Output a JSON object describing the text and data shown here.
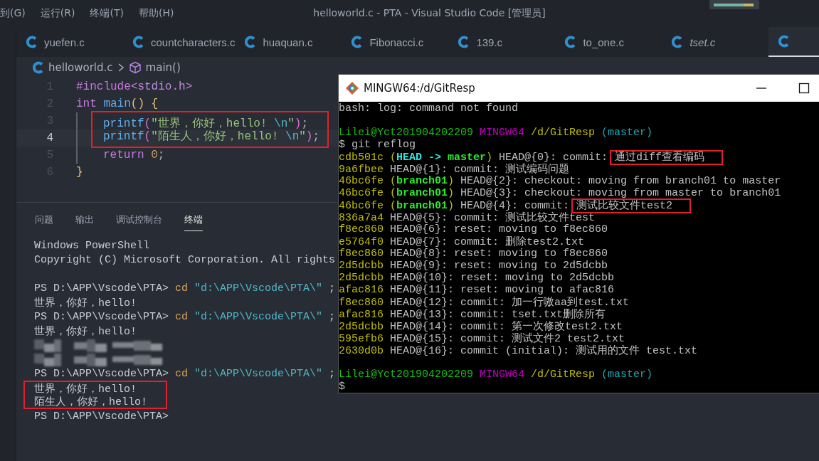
{
  "menu": [
    "到(G)",
    "运行(R)",
    "终端(T)",
    "帮助(H)"
  ],
  "window_title": "helloworld.c - PTA - Visual Studio Code [管理员]",
  "tabs": [
    {
      "label": "yuefen.c",
      "selected": false,
      "preview": false
    },
    {
      "label": "countcharacters.c",
      "selected": false,
      "preview": false
    },
    {
      "label": "huaquan.c",
      "selected": false,
      "preview": false
    },
    {
      "label": "Fibonacci.c",
      "selected": false,
      "preview": false
    },
    {
      "label": "139.c",
      "selected": false,
      "preview": false
    },
    {
      "label": "to_one.c",
      "selected": false,
      "preview": false
    },
    {
      "label": "tset.c",
      "selected": false,
      "preview": true
    },
    {
      "selected": true,
      "preview": false
    }
  ],
  "breadcrumb": {
    "file": "helloworld.c",
    "symbol": "main()"
  },
  "editor_lines": [
    {
      "number": "1",
      "current": false,
      "boxed": false,
      "indented": false,
      "tokens": [
        {
          "kind": "keyword",
          "text": "#include"
        },
        {
          "kind": "header",
          "text": "<stdio.h>"
        }
      ]
    },
    {
      "number": "2",
      "current": false,
      "boxed": false,
      "indented": false,
      "tokens": [
        {
          "kind": "keyword",
          "text": "int "
        },
        {
          "kind": "func",
          "text": "main"
        },
        {
          "kind": "bracket",
          "text": "() {"
        }
      ]
    },
    {
      "number": "3",
      "current": false,
      "boxed": true,
      "indented": true,
      "tokens": [
        {
          "kind": "func",
          "text": "printf"
        },
        {
          "kind": "bracket2",
          "text": "("
        },
        {
          "kind": "string",
          "text": "\"世界，你好，hello! "
        },
        {
          "kind": "escape",
          "text": "\\n"
        },
        {
          "kind": "string",
          "text": "\""
        },
        {
          "kind": "bracket2",
          "text": ")"
        },
        {
          "kind": "punct",
          "text": ";"
        }
      ]
    },
    {
      "number": "4",
      "current": true,
      "boxed": true,
      "indented": true,
      "tokens": [
        {
          "kind": "func",
          "text": "printf"
        },
        {
          "kind": "bracket2",
          "text": "("
        },
        {
          "kind": "string",
          "text": "\"陌生人，你好，hello! "
        },
        {
          "kind": "escape",
          "text": "\\n"
        },
        {
          "kind": "string",
          "text": "\""
        },
        {
          "kind": "bracket2",
          "text": ")"
        },
        {
          "kind": "punct",
          "text": ";"
        }
      ]
    },
    {
      "number": "5",
      "current": false,
      "boxed": false,
      "indented": true,
      "tokens": [
        {
          "kind": "keyword",
          "text": "return "
        },
        {
          "kind": "number",
          "text": "0"
        },
        {
          "kind": "punct",
          "text": ";"
        }
      ]
    },
    {
      "number": "6",
      "current": false,
      "boxed": false,
      "indented": false,
      "tokens": [
        {
          "kind": "bracket",
          "text": "}"
        }
      ]
    }
  ],
  "panel_tabs": [
    {
      "label": "问题",
      "selected": false
    },
    {
      "label": "输出",
      "selected": false
    },
    {
      "label": "调试控制台",
      "selected": false
    },
    {
      "label": "终端",
      "selected": true
    }
  ],
  "terminal_lines": [
    {
      "kind": "text",
      "boxed": false,
      "tokens": [
        {
          "kind": "plain",
          "text": "Windows PowerShell"
        }
      ]
    },
    {
      "kind": "text",
      "boxed": false,
      "tokens": [
        {
          "kind": "plain",
          "text": "Copyright (C) Microsoft Corporation. All rights"
        }
      ]
    },
    {
      "kind": "blank"
    },
    {
      "kind": "text",
      "boxed": false,
      "tokens": [
        {
          "kind": "plain",
          "text": "PS D:\\APP\\Vscode\\PTA> "
        },
        {
          "kind": "cmd",
          "text": "cd "
        },
        {
          "kind": "string",
          "text": "\"d:\\APP\\Vscode\\PTA\\\""
        },
        {
          "kind": "plain",
          "text": " ;"
        }
      ]
    },
    {
      "kind": "text",
      "boxed": false,
      "tokens": [
        {
          "kind": "plain",
          "text": "世界，你好，hello!"
        }
      ]
    },
    {
      "kind": "text",
      "boxed": false,
      "tokens": [
        {
          "kind": "plain",
          "text": "PS D:\\APP\\Vscode\\PTA> "
        },
        {
          "kind": "cmd",
          "text": "cd "
        },
        {
          "kind": "string",
          "text": "\"d:\\APP\\Vscode\\PTA\\\""
        },
        {
          "kind": "plain",
          "text": " ;"
        }
      ]
    },
    {
      "kind": "text",
      "boxed": false,
      "tokens": [
        {
          "kind": "plain",
          "text": "世界，你好，hello!"
        }
      ]
    },
    {
      "kind": "redacted"
    },
    {
      "kind": "redacted"
    },
    {
      "kind": "text",
      "boxed": false,
      "tokens": [
        {
          "kind": "plain",
          "text": "PS D:\\APP\\Vscode\\PTA> "
        },
        {
          "kind": "cmd",
          "text": "cd "
        },
        {
          "kind": "string",
          "text": "\"d:\\APP\\Vscode\\PTA\\\""
        },
        {
          "kind": "plain",
          "text": " ;"
        }
      ]
    },
    {
      "kind": "text",
      "boxed": true,
      "tokens": [
        {
          "kind": "plain",
          "text": "世界，你好，hello!"
        }
      ]
    },
    {
      "kind": "text",
      "boxed": true,
      "tokens": [
        {
          "kind": "plain",
          "text": "陌生人，你好，hello!"
        }
      ]
    },
    {
      "kind": "text",
      "boxed": false,
      "tokens": [
        {
          "kind": "plain",
          "text": "PS D:\\APP\\Vscode\\PTA>"
        }
      ]
    }
  ],
  "git_window": {
    "title": "MINGW64:/d/GitResp",
    "lines": [
      {
        "kind": "text",
        "tokens": [
          {
            "kind": "text",
            "text": "bash: log: command not found"
          }
        ]
      },
      {
        "kind": "blank"
      },
      {
        "kind": "text",
        "tokens": [
          {
            "kind": "user",
            "text": "Lilei@Yct201904202209 "
          },
          {
            "kind": "host",
            "text": "MINGW64 "
          },
          {
            "kind": "path",
            "text": "/d/GitResp "
          },
          {
            "kind": "gitbranch",
            "text": "(master)"
          }
        ]
      },
      {
        "kind": "text",
        "tokens": [
          {
            "kind": "text",
            "text": "$ git reflog"
          }
        ]
      },
      {
        "kind": "text",
        "tokens": [
          {
            "kind": "hash",
            "text": "cdb501c "
          },
          {
            "kind": "paren",
            "text": "("
          },
          {
            "kind": "head",
            "text": "HEAD -> "
          },
          {
            "kind": "branch",
            "text": "master"
          },
          {
            "kind": "paren",
            "text": ")"
          },
          {
            "kind": "text",
            "text": " HEAD@{0}: commit:"
          },
          {
            "kind": "text",
            "text": "通过diff查看编码",
            "boxed": true
          }
        ]
      },
      {
        "kind": "text",
        "tokens": [
          {
            "kind": "hash",
            "text": "9a6fbee"
          },
          {
            "kind": "text",
            "text": " HEAD@{1}: commit: 测试编码问题"
          }
        ]
      },
      {
        "kind": "text",
        "tokens": [
          {
            "kind": "hash",
            "text": "46bc6fe "
          },
          {
            "kind": "paren",
            "text": "("
          },
          {
            "kind": "branch",
            "text": "branch01"
          },
          {
            "kind": "paren",
            "text": ")"
          },
          {
            "kind": "text",
            "text": " HEAD@{2}: checkout: moving from branch01 to master"
          }
        ]
      },
      {
        "kind": "text",
        "tokens": [
          {
            "kind": "hash",
            "text": "46bc6fe "
          },
          {
            "kind": "paren",
            "text": "("
          },
          {
            "kind": "branch",
            "text": "branch01"
          },
          {
            "kind": "paren",
            "text": ")"
          },
          {
            "kind": "text",
            "text": " HEAD@{3}: checkout: moving from master to branch01"
          }
        ]
      },
      {
        "kind": "text",
        "tokens": [
          {
            "kind": "hash",
            "text": "46bc6fe "
          },
          {
            "kind": "paren",
            "text": "("
          },
          {
            "kind": "branch",
            "text": "branch01"
          },
          {
            "kind": "paren",
            "text": ")"
          },
          {
            "kind": "text",
            "text": " HEAD@{4}: commit:"
          },
          {
            "kind": "text",
            "text": "测试比较文件test2",
            "boxed": true
          }
        ]
      },
      {
        "kind": "text",
        "tokens": [
          {
            "kind": "hash",
            "text": "836a7a4"
          },
          {
            "kind": "text",
            "text": " HEAD@{5}: commit: 测试比较文件test"
          }
        ]
      },
      {
        "kind": "text",
        "tokens": [
          {
            "kind": "hash",
            "text": "f8ec860"
          },
          {
            "kind": "text",
            "text": " HEAD@{6}: reset: moving to f8ec860"
          }
        ]
      },
      {
        "kind": "text",
        "tokens": [
          {
            "kind": "hash",
            "text": "e5764f0"
          },
          {
            "kind": "text",
            "text": " HEAD@{7}: commit: 删除test2.txt"
          }
        ]
      },
      {
        "kind": "text",
        "tokens": [
          {
            "kind": "hash",
            "text": "f8ec860"
          },
          {
            "kind": "text",
            "text": " HEAD@{8}: reset: moving to f8ec860"
          }
        ]
      },
      {
        "kind": "text",
        "tokens": [
          {
            "kind": "hash",
            "text": "2d5dcbb"
          },
          {
            "kind": "text",
            "text": " HEAD@{9}: reset: moving to 2d5dcbb"
          }
        ]
      },
      {
        "kind": "text",
        "tokens": [
          {
            "kind": "hash",
            "text": "2d5dcbb"
          },
          {
            "kind": "text",
            "text": " HEAD@{10}: reset: moving to 2d5dcbb"
          }
        ]
      },
      {
        "kind": "text",
        "tokens": [
          {
            "kind": "hash",
            "text": "afac816"
          },
          {
            "kind": "text",
            "text": " HEAD@{11}: reset: moving to afac816"
          }
        ]
      },
      {
        "kind": "text",
        "tokens": [
          {
            "kind": "hash",
            "text": "f8ec860"
          },
          {
            "kind": "text",
            "text": " HEAD@{12}: commit: 加一行嗷aa到test.txt"
          }
        ]
      },
      {
        "kind": "text",
        "tokens": [
          {
            "kind": "hash",
            "text": "afac816"
          },
          {
            "kind": "text",
            "text": " HEAD@{13}: commit: tset.txt删除所有"
          }
        ]
      },
      {
        "kind": "text",
        "tokens": [
          {
            "kind": "hash",
            "text": "2d5dcbb"
          },
          {
            "kind": "text",
            "text": " HEAD@{14}: commit: 第一次修改test2.txt"
          }
        ]
      },
      {
        "kind": "text",
        "tokens": [
          {
            "kind": "hash",
            "text": "595efb6"
          },
          {
            "kind": "text",
            "text": " HEAD@{15}: commit: 测试文件2 test2.txt"
          }
        ]
      },
      {
        "kind": "text",
        "tokens": [
          {
            "kind": "hash",
            "text": "2630d0b"
          },
          {
            "kind": "text",
            "text": " HEAD@{16}: commit (initial): 测试用的文件 test.txt"
          }
        ]
      },
      {
        "kind": "blank"
      },
      {
        "kind": "text",
        "tokens": [
          {
            "kind": "user",
            "text": "Lilei@Yct201904202209 "
          },
          {
            "kind": "host",
            "text": "MINGW64 "
          },
          {
            "kind": "path",
            "text": "/d/GitResp "
          },
          {
            "kind": "gitbranch",
            "text": "(master)"
          }
        ]
      },
      {
        "kind": "text",
        "tokens": [
          {
            "kind": "text",
            "text": "$"
          }
        ]
      }
    ]
  }
}
